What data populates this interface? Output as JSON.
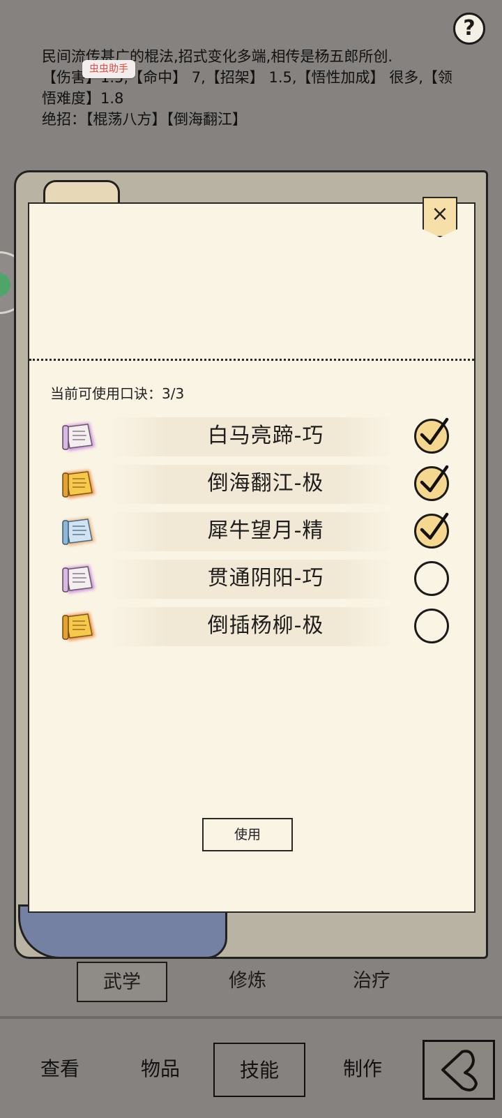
{
  "description": {
    "line1": "民间流传甚广的棍法,招式变化多端,相传是杨五郎所创.",
    "line2": "【伤害】1.5,【命中】 7,【招架】 1.5,【悟性加成】 很多,【领",
    "line3": "悟难度】1.8",
    "line4": "绝招：【棍荡八方】【倒海翻江】"
  },
  "overlay_badge": "虫虫助手",
  "help_label": "?",
  "panel": {
    "close_label": "×",
    "available_label": "当前可使用口诀：",
    "available_count": "3/3",
    "items": [
      {
        "name": "白马亮蹄-巧",
        "icon": "purple-scroll-icon",
        "checked": true
      },
      {
        "name": "倒海翻江-极",
        "icon": "gold-scroll-icon",
        "checked": true
      },
      {
        "name": "犀牛望月-精",
        "icon": "blue-scroll-icon",
        "checked": true
      },
      {
        "name": "贯通阴阳-巧",
        "icon": "purple-scroll-icon",
        "checked": false
      },
      {
        "name": "倒插杨柳-极",
        "icon": "gold-scroll-icon",
        "checked": false
      }
    ],
    "use_button": "使用"
  },
  "subtabs": [
    "武学",
    "修炼",
    "治疗"
  ],
  "bottom_nav": [
    "查看",
    "物品",
    "技能",
    "制作"
  ],
  "colors": {
    "background": "#858280",
    "paper": "#faf4e5",
    "check_fill": "#f6d78f",
    "purple_glow": "#c070e0",
    "gold_glow": "#f07a20",
    "blue_glow": "#e8a060"
  }
}
